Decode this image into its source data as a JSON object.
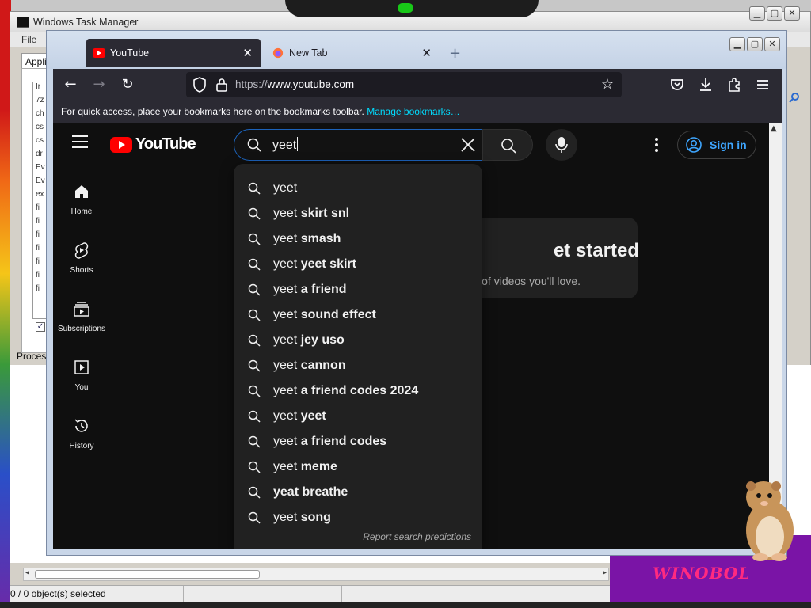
{
  "task_manager": {
    "title": "Windows Task Manager",
    "menu_file": "File",
    "tab_label": "Applic",
    "list_items": [
      "Ir",
      "7z",
      "ch",
      "cs",
      "cs",
      "dr",
      "Ev",
      "Ev",
      "ex",
      "fi",
      "fi",
      "fi",
      "fi",
      "fi",
      "fi",
      "fi"
    ],
    "processes_label": "Proces",
    "status_text": "0 / 0 object(s) selected",
    "win_buttons": [
      "minimize",
      "maximize",
      "close"
    ]
  },
  "browser": {
    "tabs": [
      {
        "label": "YouTube",
        "active": true,
        "icon": "youtube-favicon"
      },
      {
        "label": "New Tab",
        "active": false,
        "icon": "firefox-favicon"
      }
    ],
    "new_tab_symbol": "+",
    "url": {
      "scheme": "https://",
      "host": "www.youtube.com"
    },
    "bookmarks_message": "For quick access, place your bookmarks here on the bookmarks toolbar.",
    "bookmarks_link": "Manage bookmarks…",
    "nav_icons": [
      "back-icon",
      "forward-icon",
      "reload-icon",
      "shield-icon",
      "lock-icon",
      "star-icon",
      "pocket-icon",
      "download-icon",
      "extensions-icon",
      "menu-icon"
    ]
  },
  "youtube": {
    "logo_text": "YouTube",
    "search_query": "yeet",
    "signin_label": "Sign in",
    "sidebar": [
      {
        "label": "Home",
        "icon": "home-icon"
      },
      {
        "label": "Shorts",
        "icon": "shorts-icon"
      },
      {
        "label": "Subscriptions",
        "icon": "subscriptions-icon"
      },
      {
        "label": "You",
        "icon": "you-icon"
      },
      {
        "label": "History",
        "icon": "history-icon"
      }
    ],
    "card_title": "et started",
    "card_subtitle": "eed of videos you'll love.",
    "suggestions": [
      {
        "prefix": "yeet",
        "suffix": ""
      },
      {
        "prefix": "yeet",
        "suffix": " skirt snl"
      },
      {
        "prefix": "yeet",
        "suffix": " smash"
      },
      {
        "prefix": "yeet",
        "suffix": " yeet skirt"
      },
      {
        "prefix": "yeet",
        "suffix": " a friend"
      },
      {
        "prefix": "yeet",
        "suffix": " sound effect"
      },
      {
        "prefix": "yeet",
        "suffix": " jey uso"
      },
      {
        "prefix": "yeet",
        "suffix": " cannon"
      },
      {
        "prefix": "yeet",
        "suffix": " a friend codes 2024"
      },
      {
        "prefix": "yeet",
        "suffix": " yeet"
      },
      {
        "prefix": "yeet",
        "suffix": " a friend codes"
      },
      {
        "prefix": "yeet",
        "suffix": " meme"
      },
      {
        "prefix": "",
        "suffix": "yeat breathe"
      },
      {
        "prefix": "yeet",
        "suffix": " song"
      }
    ],
    "report_label": "Report search predictions"
  },
  "desktop": {
    "purple_banner_text": "WINOBOL"
  },
  "colors": {
    "youtube_red": "#ff0000",
    "signin_blue": "#3ea6ff",
    "search_focus_border": "#1c62b9",
    "firefox_toolbar": "#2b2a33",
    "bookmark_link": "#00ddff"
  }
}
